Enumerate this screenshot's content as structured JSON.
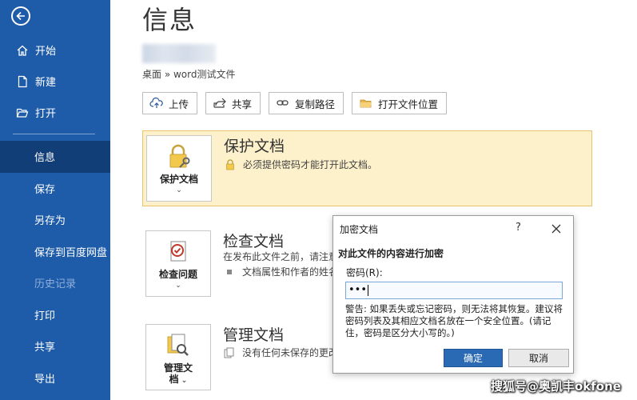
{
  "sidebar": {
    "back_label": "",
    "top_items": [
      {
        "label": "开始",
        "icon": "home-icon"
      },
      {
        "label": "新建",
        "icon": "new-document-icon"
      },
      {
        "label": "打开",
        "icon": "folder-open-icon"
      }
    ],
    "items": [
      {
        "label": "信息",
        "state": "active"
      },
      {
        "label": "保存",
        "state": "normal"
      },
      {
        "label": "另存为",
        "state": "normal"
      },
      {
        "label": "保存到百度网盘",
        "state": "normal"
      },
      {
        "label": "历史记录",
        "state": "disabled"
      },
      {
        "label": "打印",
        "state": "normal"
      },
      {
        "label": "共享",
        "state": "normal"
      },
      {
        "label": "导出",
        "state": "normal"
      }
    ]
  },
  "main": {
    "title": "信息",
    "path": "桌面 » word测试文件",
    "toolbar": {
      "upload": "上传",
      "share": "共享",
      "copy_path": "复制路径",
      "open_location": "打开文件位置"
    },
    "protect": {
      "tile_label": "保护文档",
      "title": "保护文档",
      "desc": "必须提供密码才能打开此文档。"
    },
    "inspect": {
      "tile_label": "检查问题",
      "title": "检查文档",
      "desc1": "在发布此文件之前，请注意",
      "desc2": "文档属性和作者的姓名"
    },
    "manage": {
      "tile_label_line1": "管理文",
      "tile_label_line2": "档",
      "title": "管理文档",
      "desc": "没有任何未保存的更改"
    }
  },
  "dialog": {
    "title": "加密文档",
    "help": "?",
    "heading": "对此文件的内容进行加密",
    "password_label": "密码(R):",
    "password_value": "•••",
    "warning": "警告: 如果丢失或忘记密码，则无法将其恢复。建议将密码列表及其相应文档名放在一个安全位置。(请记住，密码是区分大小写的。)",
    "ok": "确定",
    "cancel": "取消"
  },
  "watermark": "搜狐号@奥凯丰okfone",
  "colors": {
    "sidebar": "#1e5ba8",
    "sidebar_active": "#123e78",
    "highlight": "#fdf1cb",
    "highlight_border": "#e8c36a",
    "ok_button": "#2a6ab5"
  }
}
